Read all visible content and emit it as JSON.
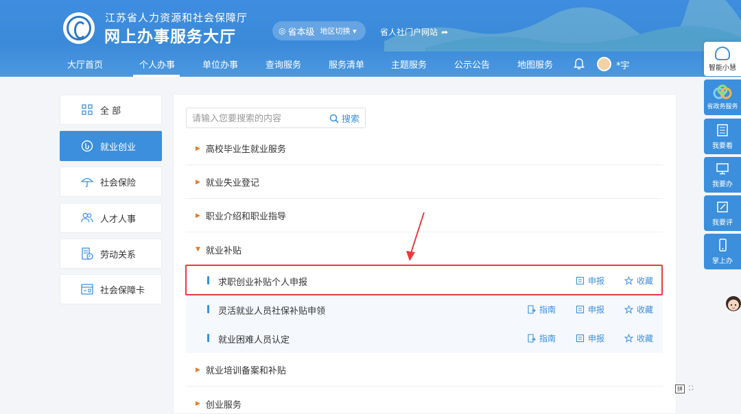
{
  "header": {
    "org_sub": "江苏省人力资源和社会保障厅",
    "org_main": "网上办事服务大厅",
    "region": "省本级",
    "region_switch": "地区切换 ▾",
    "portal_link": "省人社门户网站",
    "user_name": "*宇"
  },
  "nav": [
    "大厅首页",
    "个人办事",
    "单位办事",
    "查询服务",
    "服务清单",
    "主题服务",
    "公示公告",
    "地图服务"
  ],
  "sidebar": [
    {
      "label": "全 部",
      "icon": "grid-icon"
    },
    {
      "label": "就业创业",
      "icon": "employment-icon"
    },
    {
      "label": "社会保险",
      "icon": "umbrella-icon"
    },
    {
      "label": "人才人事",
      "icon": "people-icon"
    },
    {
      "label": "劳动关系",
      "icon": "document-icon"
    },
    {
      "label": "社会保障卡",
      "icon": "card-icon"
    }
  ],
  "search": {
    "placeholder": "请输入您要搜索的内容",
    "button": "搜索"
  },
  "categories": [
    "高校毕业生就业服务",
    "就业失业登记",
    "职业介绍和职业指导",
    "就业补贴",
    "就业培训备案和补贴",
    "创业服务"
  ],
  "subitems": [
    {
      "title": "求职创业补贴个人申报",
      "guide": "",
      "apply": "申报",
      "fav": "收藏"
    },
    {
      "title": "灵活就业人员社保补贴申领",
      "guide": "指南",
      "apply": "申报",
      "fav": "收藏"
    },
    {
      "title": "就业困难人员认定",
      "guide": "指南",
      "apply": "申报",
      "fav": "收藏"
    }
  ],
  "right_toolbar": {
    "assistant": "智能小慧",
    "gov_service": "省政务服务",
    "tools": [
      "我要看",
      "我要办",
      "我要评",
      "掌上办"
    ]
  },
  "keyboard_label": "拼",
  "colors": {
    "primary": "#3b8fdc",
    "accent_arrow": "#e47c2c",
    "highlight": "#e93a3a"
  }
}
